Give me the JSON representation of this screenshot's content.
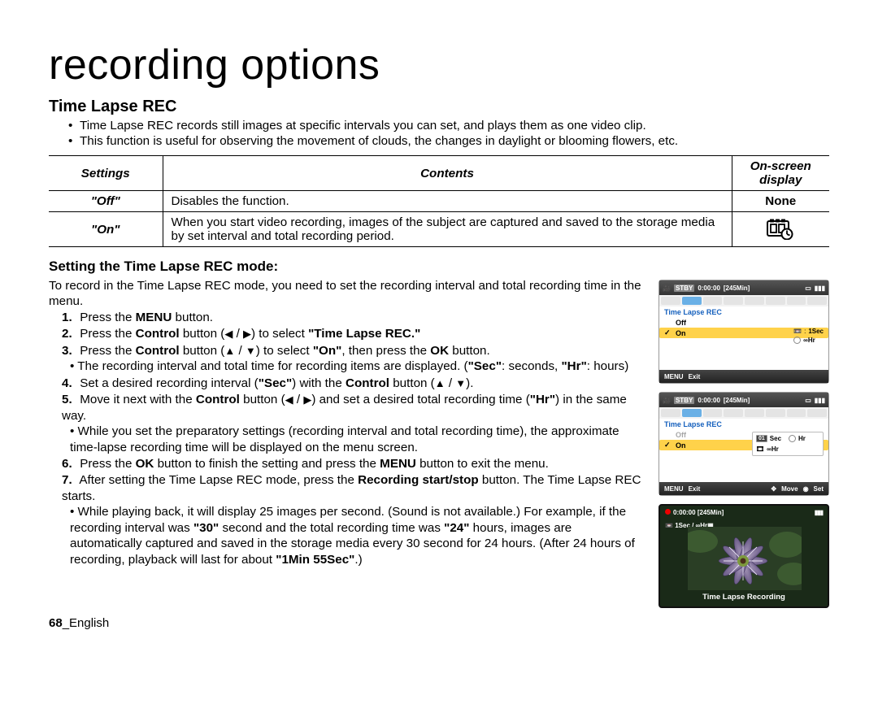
{
  "chapterTitle": "recording options",
  "section": {
    "heading": "Time Lapse REC",
    "bullets": [
      "Time Lapse REC records still images at specific intervals you can set, and plays them as one video clip.",
      "This function is useful for observing the movement of clouds, the changes in daylight or blooming flowers, etc."
    ]
  },
  "table": {
    "headers": {
      "c1": "Settings",
      "c2": "Contents",
      "c3": "On-screen display"
    },
    "rows": {
      "off": {
        "setting": "\"Off\"",
        "contents": "Disables the function.",
        "display": "None"
      },
      "on": {
        "setting": "\"On\"",
        "contents": "When you start video recording, images of the subject are captured and saved to the storage media by set interval and total recording period."
      }
    }
  },
  "subHeading": "Setting the Time Lapse REC mode:",
  "introPara": "To record in the Time Lapse REC mode, you need to set the recording interval and total recording time in the menu.",
  "steps": {
    "s1a": "Press the ",
    "s1b": "MENU",
    "s1c": " button.",
    "s2a": "Press the ",
    "s2b": "Control",
    "s2c": " button (",
    "s2d": " / ",
    "s2e": ") to select ",
    "s2f": "\"Time Lapse REC.\"",
    "s3a": "Press the ",
    "s3b": "Control",
    "s3c": " button (",
    "s3d": " / ",
    "s3e": ") to select ",
    "s3f": "\"On\"",
    "s3g": ", then press the ",
    "s3h": "OK",
    "s3i": " button.",
    "s3sub1a": "The recording interval and total time for recording items are displayed. (",
    "s3sub1b": "\"Sec\"",
    "s3sub1c": ": seconds, ",
    "s3sub1d": "\"Hr\"",
    "s3sub1e": ": hours)",
    "s4a": "Set a desired recording interval (",
    "s4b": "\"Sec\"",
    "s4c": ") with the ",
    "s4d": "Control",
    "s4e": " button (",
    "s4f": " / ",
    "s4g": ").",
    "s5a": "Move it next with the ",
    "s5b": "Control",
    "s5c": " button (",
    "s5d": " / ",
    "s5e": ") and set a desired total recording time (",
    "s5f": "\"Hr\"",
    "s5g": ") in the same way.",
    "s5sub1": "While you set the preparatory settings (recording interval and total recording time), the approximate time-lapse recording time will be displayed on the menu screen.",
    "s6a": "Press the ",
    "s6b": "OK",
    "s6c": " button to finish the setting and press the ",
    "s6d": "MENU",
    "s6e": " button to exit the menu.",
    "s7a": "After setting the Time Lapse REC mode, press the ",
    "s7b": "Recording start/stop",
    "s7c": " button. The Time Lapse REC starts.",
    "s7sub1a": "While playing back, it will display 25 images per second. (Sound is not available.) For example, if the recording interval was ",
    "s7sub1b": "\"30\"",
    "s7sub1c": " second and the total recording time was ",
    "s7sub1d": "\"24\"",
    "s7sub1e": " hours, images are automatically captured and saved in the storage media every 30 second for 24 hours. (After 24 hours of recording, playback will last for about ",
    "s7sub1f": "\"1Min 55Sec\"",
    "s7sub1g": ".)"
  },
  "lcd1": {
    "stby": "STBY",
    "time": "0:00:00",
    "remain": "[245Min]",
    "menuTitle": "Time Lapse REC",
    "off": "Off",
    "on": "On",
    "right1": "1Sec",
    "right2": "∞Hr",
    "exit": "Exit",
    "menuLabel": "MENU"
  },
  "lcd2": {
    "stby": "STBY",
    "time": "0:00:00",
    "remain": "[245Min]",
    "menuTitle": "Time Lapse REC",
    "off": "Off",
    "on": "On",
    "secVal": "01",
    "secLabel": "Sec",
    "hrLabel": "Hr",
    "bottomVal": "∞Hr",
    "exit": "Exit",
    "move": "Move",
    "set": "Set",
    "menuLabel": "MENU"
  },
  "lcd3": {
    "time": "0:00:00",
    "remain": "[245Min]",
    "mid": "1Sec / ∞Hr",
    "caption": "Time Lapse Recording"
  },
  "footer": {
    "page": "68",
    "lang": "English",
    "sep": "_"
  }
}
